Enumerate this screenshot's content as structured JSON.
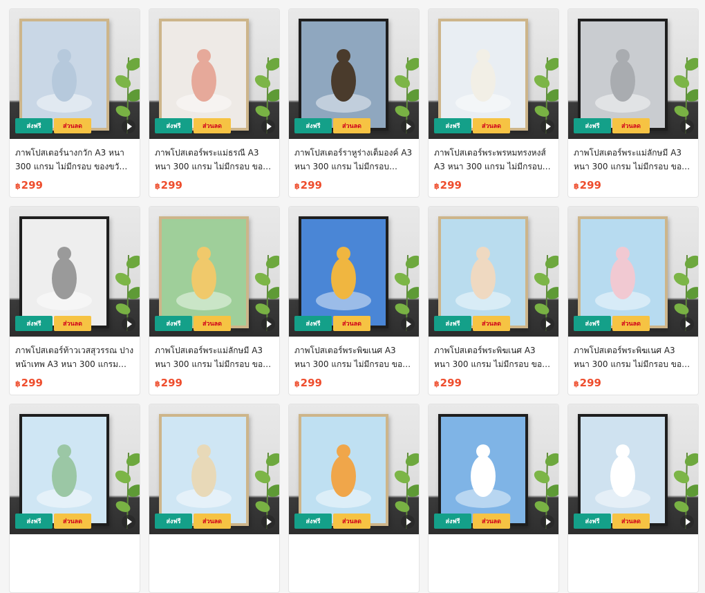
{
  "badges": {
    "free": "ส่งฟรี",
    "sale": "ส่วนลด"
  },
  "currency": "฿",
  "products": [
    {
      "title": "ภาพโปสเตอร์นางกวัก A3 หนา 300 แกรม ไม่มีกรอบ ของขวัญความ...",
      "price": "299",
      "art": "#c9d7e6",
      "figure": "#b6c9dc",
      "frame": "wood"
    },
    {
      "title": "ภาพโปสเตอร์พระแม่ธรณี A3 หนา 300 แกรม ไม่มีกรอบ ของขวัญ...",
      "price": "299",
      "art": "#eeeae6",
      "figure": "#e6a99a",
      "frame": "wood"
    },
    {
      "title": "ภาพโปสเตอร์ราหูร่างเต็มองค์ A3 หนา 300 แกรม ไม่มีกรอบ ของข...",
      "price": "299",
      "art": "#8fa7bf",
      "figure": "#4a3b2c",
      "frame": "dark"
    },
    {
      "title": "ภาพโปสเตอร์พระพรหมทรงหงส์ A3 หนา 300 แกรม ไม่มีกรอบ ของข...",
      "price": "299",
      "art": "#e9eef3",
      "figure": "#f2efe6",
      "frame": "wood"
    },
    {
      "title": "ภาพโปสเตอร์พระแม่ลักษมี A3 หนา 300 แกรม ไม่มีกรอบ ของขวัญ...",
      "price": "299",
      "art": "#c9ccd0",
      "figure": "#a9acb0",
      "frame": "dark"
    },
    {
      "title": "ภาพโปสเตอร์ท้าวเวสสุวรรณ ปางหน้าเทพ A3 หนา 300 แกรม ไม่มี...",
      "price": "299",
      "art": "#eeeeee",
      "figure": "#9a9a9a",
      "frame": "dark"
    },
    {
      "title": "ภาพโปสเตอร์พระแม่ลักษมี A3 หนา 300 แกรม ไม่มีกรอบ ของขวัญ...",
      "price": "299",
      "art": "#9fcf9a",
      "figure": "#f0c96b",
      "frame": "wood"
    },
    {
      "title": "ภาพโปสเตอร์พระพิฆเนศ A3 หนา 300 แกรม ไม่มีกรอบ ของขวัญ...",
      "price": "299",
      "art": "#4a86d6",
      "figure": "#f0b640",
      "frame": "dark"
    },
    {
      "title": "ภาพโปสเตอร์พระพิฆเนศ A3 หนา 300 แกรม ไม่มีกรอบ ของขวัญ...",
      "price": "299",
      "art": "#b9dcee",
      "figure": "#efd9c1",
      "frame": "wood"
    },
    {
      "title": "ภาพโปสเตอร์พระพิฆเนศ A3 หนา 300 แกรม ไม่มีกรอบ ของขวัญ...",
      "price": "299",
      "art": "#b7dbf0",
      "figure": "#f1c9d2",
      "frame": "wood"
    },
    {
      "title": "",
      "price": "",
      "art": "#cfe6f4",
      "figure": "#9bc7a5",
      "frame": "dark"
    },
    {
      "title": "",
      "price": "",
      "art": "#cfe6f4",
      "figure": "#e8d9b8",
      "frame": "wood"
    },
    {
      "title": "",
      "price": "",
      "art": "#bfe0f2",
      "figure": "#f0a64a",
      "frame": "wood"
    },
    {
      "title": "",
      "price": "",
      "art": "#7fb4e6",
      "figure": "#ffffff",
      "frame": "dark"
    },
    {
      "title": "",
      "price": "",
      "art": "#cfe2f0",
      "figure": "#ffffff",
      "frame": "dark"
    }
  ]
}
